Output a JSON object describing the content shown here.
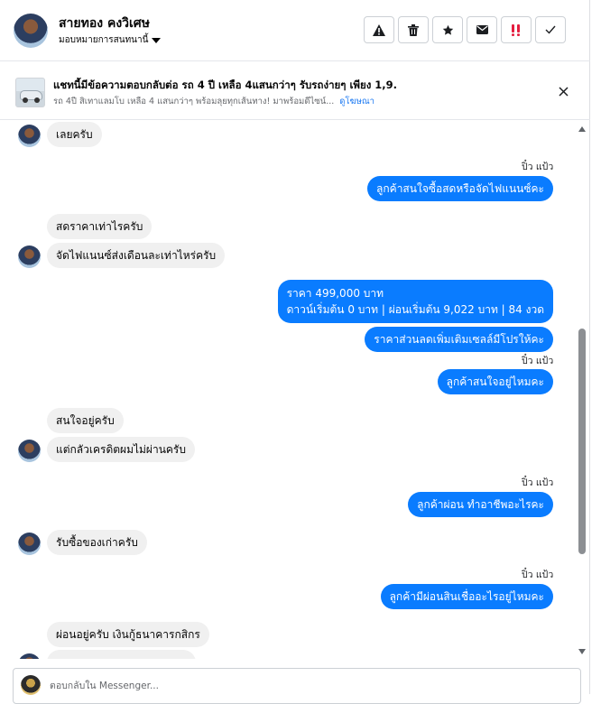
{
  "header": {
    "contact_name": "สายทอง คงวิเศษ",
    "assign_label": "มอบหมายการสนทนานี้",
    "toolbar_icons": [
      "alert-icon",
      "trash-icon",
      "star-icon",
      "envelope-icon",
      "spam-icon",
      "check-icon"
    ]
  },
  "banner": {
    "title": "แชทนี้มีข้อความตอบกลับต่อ รถ 4 ปี เหลือ 4แสนกว่าๆ รับรถง่ายๆ เพียง 1,9...",
    "subtitle": "รถ 4ปี สิเทาแลมโบ เหลือ 4 แสนกว่าๆ พร้อมลุยทุกเส้นทาง! มาพร้อมดีไซน์...",
    "link": "ดูโฆษณา"
  },
  "messages": {
    "m1": "เลยครับ",
    "s1": "ปิ๋ว แป้ว",
    "m2": "ลูกค้าสนใจซื้อสดหรือจัดไฟแนนซ์คะ",
    "m3": "สดราคาเท่าไรครับ",
    "m4": "จัดไฟแนนซ์ส่งเดือนละเท่าไหร่ครับ",
    "m5_line1": "ราคา 499,000 บาท",
    "m5_line2": "ดาวน์เริ่มต้น 0 บาท | ผ่อนเริ่มต้น 9,022 บาท | 84 งวด",
    "m6": "ราคาส่วนลดเพิ่มเติมเซลล์มีโปรให้คะ",
    "s2": "ปิ๋ว แป้ว",
    "m7": "ลูกค้าสนใจอยู่ไหมคะ",
    "m8": "สนใจอยู่ครับ",
    "m9": "แต่กลัวเครดิตผมไม่ผ่านครับ",
    "s3": "ปิ๋ว แป้ว",
    "m10": "ลูกค้าผ่อน  ทำอาชีพอะไรคะ",
    "m11": "รับซื้อของเก่าครับ",
    "s4": "ปิ๋ว แป้ว",
    "m12": "ลูกค้ามีผ่อนสินเชื่ออะไรอยู่ไหมคะ",
    "m13": "ผ่อนอยู่ครับ เงินกู้ธนาคารกสิกร"
  },
  "composer": {
    "placeholder": "ตอบกลับใน Messenger..."
  },
  "colors": {
    "outgoing_bubble": "#0a7cff",
    "incoming_bubble": "#f0f0f0",
    "link": "#1877f2"
  }
}
